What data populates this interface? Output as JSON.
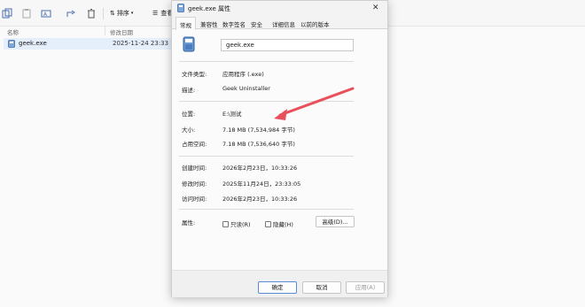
{
  "toolbar": {
    "sort_label": "排序",
    "view_label": "查看"
  },
  "columns": {
    "name": "名称",
    "modified": "修改日期"
  },
  "file": {
    "name": "geek.exe",
    "modified": "2025-11-24 23:33"
  },
  "dialog": {
    "title": "geek.exe 属性",
    "close": "✕",
    "tabs": [
      "常规",
      "兼容性",
      "数字签名",
      "安全",
      "详细信息",
      "以前的版本"
    ],
    "filename": "geek.exe",
    "fields": {
      "type_label": "文件类型:",
      "type_value": "应用程序 (.exe)",
      "desc_label": "描述:",
      "desc_value": "Geek Uninstaller",
      "location_label": "位置:",
      "location_value": "E:\\测试",
      "size_label": "大小:",
      "size_value": "7.18 MB (7,534,984 字节)",
      "disk_label": "占用空间:",
      "disk_value": "7.18 MB (7,536,640 字节)",
      "created_label": "创建时间:",
      "created_value": "2026年2月23日，10:33:26",
      "modified_label": "修改时间:",
      "modified_value": "2025年11月24日，23:33:05",
      "accessed_label": "访问时间:",
      "accessed_value": "2026年2月23日，10:33:26",
      "attr_label": "属性:",
      "readonly_label": "只读(R)",
      "hidden_label": "隐藏(H)",
      "advanced_label": "高级(D)..."
    },
    "buttons": {
      "ok": "确定",
      "cancel": "取消",
      "apply": "应用(A)"
    }
  },
  "colors": {
    "annotation_arrow": "#e8505b",
    "selection": "#e5eefb"
  }
}
